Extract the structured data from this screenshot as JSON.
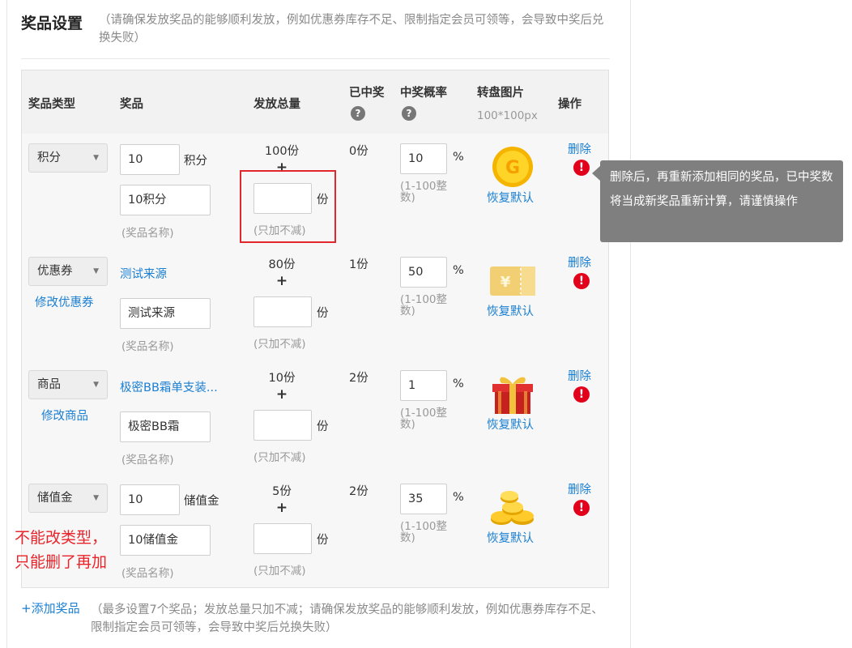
{
  "section": {
    "title": "奖品设置",
    "note": "（请确保发放奖品的能够顺利发放，例如优惠券库存不足、限制指定会员可领等，会导致中奖后兑换失败）"
  },
  "headers": {
    "type": "奖品类型",
    "prize": "奖品",
    "total": "发放总量",
    "won": "已中奖",
    "prob": "中奖概率",
    "image": "转盘图片",
    "image_size": "100*100px",
    "action": "操作",
    "help_glyph": "?"
  },
  "common": {
    "share_unit": "份",
    "plus": "+",
    "only_add": "(只加不减)",
    "name_hint": "(奖品名称)",
    "percent": "%",
    "prob_range": "(1-100整数)",
    "restore": "恢复默认",
    "delete": "删除",
    "warn_glyph": "!"
  },
  "rows": [
    {
      "type": "积分",
      "amount": "10",
      "unit": "积分",
      "name": "10积分",
      "total": "100份",
      "won": "0份",
      "prob": "10",
      "icon": "coin-g-icon",
      "icon_letter": "G"
    },
    {
      "type": "优惠券",
      "modify": "修改优惠券",
      "link": "测试来源",
      "name": "测试来源",
      "total": "80份",
      "won": "1份",
      "prob": "50",
      "icon": "coupon-icon",
      "icon_letter": "¥"
    },
    {
      "type": "商品",
      "modify": "修改商品",
      "link": "极密BB霜单支装...",
      "name": "极密BB霜",
      "total": "10份",
      "won": "2份",
      "prob": "1",
      "icon": "gift-box-icon"
    },
    {
      "type": "储值金",
      "amount": "10",
      "unit": "储值金",
      "name": "10储值金",
      "total": "5份",
      "won": "2份",
      "prob": "35",
      "icon": "gold-coins-icon"
    }
  ],
  "tooltip": "删除后，再重新添加相同的奖品，已中奖数将当成新奖品重新计算，请谨慎操作",
  "annotation": {
    "line1": "不能改类型，",
    "line2": "只能删了再加"
  },
  "footer": {
    "add_label": "+添加奖品",
    "note": "（最多设置7个奖品；发放总量只加不减；请确保发放奖品的能够顺利发放，例如优惠券库存不足、限制指定会员可领等，会导致中奖后兑换失败）"
  },
  "colors": {
    "link": "#1b7fd1",
    "danger": "#e3001b",
    "annotation": "#e8242a",
    "tooltip_bg": "#7f7f7f"
  }
}
